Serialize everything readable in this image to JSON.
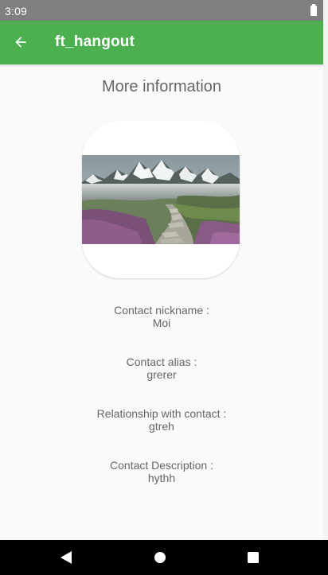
{
  "status_bar": {
    "time": "3:09",
    "battery_icon": "battery-full-icon"
  },
  "app_bar": {
    "back_icon": "arrow-back-icon",
    "title": "ft_hangout",
    "color": "#4caf50"
  },
  "page": {
    "heading": "More information"
  },
  "contact": {
    "photo_icon": "landscape-photo",
    "fields": [
      {
        "label": "Contact nickname :",
        "value": "Moi"
      },
      {
        "label": "Contact alias :",
        "value": "grerer"
      },
      {
        "label": "Relationship with contact :",
        "value": "gtreh"
      },
      {
        "label": "Contact Description :",
        "value": "hythh"
      }
    ]
  },
  "nav_bar": {
    "back_icon": "triangle-back-icon",
    "home_icon": "circle-home-icon",
    "recents_icon": "square-recents-icon"
  }
}
